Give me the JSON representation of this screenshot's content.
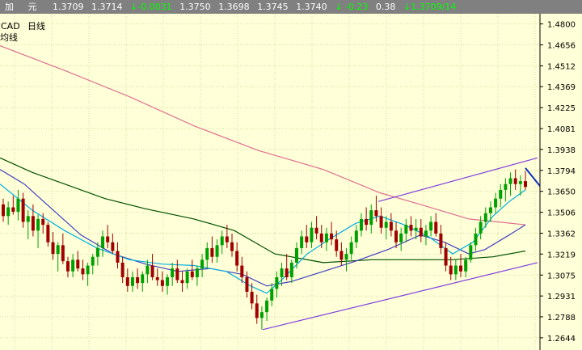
{
  "quote_bar": {
    "label1": "加",
    "label2": "元",
    "open": "1.3709",
    "high": "1.3714",
    "change_arrow": "↓",
    "change": "-0.0031",
    "v1": "1.3750",
    "v2": "1.3698",
    "v3": "1.3745",
    "v4": "1.3740",
    "pct_arrow": "↓",
    "pct": "-0.23",
    "vol": "0.38",
    "last_arrow": "↓",
    "last": "1.3709/14"
  },
  "colors": {
    "background": "#ffffd8",
    "grid": "#cfe0a0",
    "up_candle": "#00a000",
    "down_candle": "#a00000",
    "ma_fast": "#00b0e0",
    "ma_mid": "#4040c0",
    "ma_slow": "#005000",
    "ma_long": "#e07090",
    "channel": "#8040e0",
    "arrow": "#1030c0"
  },
  "chart_data": {
    "type": "candlestick",
    "symbol": "CAD",
    "timeframe": "日线",
    "sub_label": "均线",
    "y_ticks": [
      "1.4800",
      "1.4656",
      "1.4512",
      "1.4369",
      "1.4225",
      "1.4081",
      "1.3938",
      "1.3794",
      "1.3650",
      "1.3506",
      "1.3362",
      "1.3219",
      "1.3075",
      "1.2931",
      "1.2788",
      "1.2644"
    ],
    "ylim": [
      1.256,
      1.487
    ],
    "x_range": [
      0,
      720
    ],
    "candles": [
      [
        1.356,
        1.36,
        1.344,
        1.348
      ],
      [
        1.348,
        1.358,
        1.342,
        1.354
      ],
      [
        1.354,
        1.362,
        1.349,
        1.351
      ],
      [
        1.351,
        1.366,
        1.345,
        1.36
      ],
      [
        1.36,
        1.364,
        1.34,
        1.344
      ],
      [
        1.344,
        1.352,
        1.332,
        1.348
      ],
      [
        1.348,
        1.356,
        1.334,
        1.338
      ],
      [
        1.338,
        1.349,
        1.326,
        1.346
      ],
      [
        1.346,
        1.35,
        1.336,
        1.342
      ],
      [
        1.342,
        1.344,
        1.327,
        1.33
      ],
      [
        1.33,
        1.337,
        1.318,
        1.322
      ],
      [
        1.322,
        1.33,
        1.31,
        1.328
      ],
      [
        1.328,
        1.336,
        1.315,
        1.317
      ],
      [
        1.317,
        1.32,
        1.306,
        1.31
      ],
      [
        1.31,
        1.322,
        1.306,
        1.318
      ],
      [
        1.318,
        1.324,
        1.31,
        1.312
      ],
      [
        1.312,
        1.318,
        1.304,
        1.308
      ],
      [
        1.308,
        1.316,
        1.3,
        1.314
      ],
      [
        1.314,
        1.322,
        1.308,
        1.32
      ],
      [
        1.32,
        1.33,
        1.314,
        1.326
      ],
      [
        1.326,
        1.338,
        1.32,
        1.334
      ],
      [
        1.334,
        1.342,
        1.326,
        1.33
      ],
      [
        1.33,
        1.336,
        1.322,
        1.324
      ],
      [
        1.324,
        1.33,
        1.312,
        1.316
      ],
      [
        1.316,
        1.32,
        1.302,
        1.306
      ],
      [
        1.306,
        1.312,
        1.296,
        1.3
      ],
      [
        1.3,
        1.31,
        1.296,
        1.306
      ],
      [
        1.306,
        1.312,
        1.298,
        1.302
      ],
      [
        1.302,
        1.31,
        1.296,
        1.308
      ],
      [
        1.308,
        1.318,
        1.302,
        1.314
      ],
      [
        1.314,
        1.322,
        1.304,
        1.306
      ],
      [
        1.306,
        1.312,
        1.3,
        1.304
      ],
      [
        1.304,
        1.31,
        1.296,
        1.3
      ],
      [
        1.3,
        1.308,
        1.294,
        1.306
      ],
      [
        1.306,
        1.316,
        1.3,
        1.312
      ],
      [
        1.312,
        1.318,
        1.302,
        1.304
      ],
      [
        1.304,
        1.31,
        1.296,
        1.302
      ],
      [
        1.302,
        1.312,
        1.298,
        1.31
      ],
      [
        1.31,
        1.318,
        1.304,
        1.306
      ],
      [
        1.306,
        1.314,
        1.3,
        1.312
      ],
      [
        1.312,
        1.322,
        1.306,
        1.318
      ],
      [
        1.318,
        1.33,
        1.312,
        1.326
      ],
      [
        1.326,
        1.334,
        1.316,
        1.32
      ],
      [
        1.32,
        1.332,
        1.316,
        1.328
      ],
      [
        1.328,
        1.338,
        1.322,
        1.334
      ],
      [
        1.334,
        1.342,
        1.326,
        1.33
      ],
      [
        1.33,
        1.336,
        1.32,
        1.324
      ],
      [
        1.324,
        1.33,
        1.31,
        1.314
      ],
      [
        1.314,
        1.32,
        1.302,
        1.306
      ],
      [
        1.306,
        1.31,
        1.292,
        1.296
      ],
      [
        1.296,
        1.302,
        1.284,
        1.288
      ],
      [
        1.288,
        1.294,
        1.274,
        1.278
      ],
      [
        1.278,
        1.286,
        1.27,
        1.282
      ],
      [
        1.282,
        1.292,
        1.276,
        1.29
      ],
      [
        1.29,
        1.302,
        1.286,
        1.298
      ],
      [
        1.298,
        1.31,
        1.292,
        1.306
      ],
      [
        1.306,
        1.316,
        1.3,
        1.312
      ],
      [
        1.312,
        1.322,
        1.304,
        1.306
      ],
      [
        1.306,
        1.318,
        1.302,
        1.316
      ],
      [
        1.316,
        1.33,
        1.312,
        1.326
      ],
      [
        1.326,
        1.338,
        1.322,
        1.334
      ],
      [
        1.334,
        1.342,
        1.326,
        1.33
      ],
      [
        1.33,
        1.344,
        1.326,
        1.34
      ],
      [
        1.34,
        1.348,
        1.332,
        1.336
      ],
      [
        1.336,
        1.342,
        1.326,
        1.33
      ],
      [
        1.33,
        1.34,
        1.324,
        1.336
      ],
      [
        1.336,
        1.344,
        1.328,
        1.332
      ],
      [
        1.332,
        1.338,
        1.32,
        1.324
      ],
      [
        1.324,
        1.33,
        1.314,
        1.318
      ],
      [
        1.318,
        1.326,
        1.31,
        1.322
      ],
      [
        1.322,
        1.334,
        1.318,
        1.33
      ],
      [
        1.33,
        1.342,
        1.326,
        1.338
      ],
      [
        1.338,
        1.35,
        1.334,
        1.346
      ],
      [
        1.346,
        1.354,
        1.338,
        1.342
      ],
      [
        1.342,
        1.356,
        1.336,
        1.352
      ],
      [
        1.352,
        1.362,
        1.344,
        1.348
      ],
      [
        1.348,
        1.354,
        1.336,
        1.34
      ],
      [
        1.34,
        1.348,
        1.332,
        1.344
      ],
      [
        1.344,
        1.35,
        1.334,
        1.338
      ],
      [
        1.338,
        1.344,
        1.326,
        1.33
      ],
      [
        1.33,
        1.34,
        1.324,
        1.336
      ],
      [
        1.336,
        1.346,
        1.33,
        1.342
      ],
      [
        1.342,
        1.348,
        1.334,
        1.338
      ],
      [
        1.338,
        1.346,
        1.332,
        1.34
      ],
      [
        1.34,
        1.346,
        1.33,
        1.334
      ],
      [
        1.334,
        1.342,
        1.328,
        1.338
      ],
      [
        1.338,
        1.348,
        1.334,
        1.344
      ],
      [
        1.344,
        1.35,
        1.334,
        1.336
      ],
      [
        1.336,
        1.342,
        1.322,
        1.326
      ],
      [
        1.326,
        1.33,
        1.31,
        1.314
      ],
      [
        1.314,
        1.32,
        1.304,
        1.308
      ],
      [
        1.308,
        1.318,
        1.304,
        1.314
      ],
      [
        1.314,
        1.322,
        1.306,
        1.31
      ],
      [
        1.31,
        1.32,
        1.306,
        1.318
      ],
      [
        1.318,
        1.33,
        1.316,
        1.328
      ],
      [
        1.328,
        1.34,
        1.324,
        1.336
      ],
      [
        1.336,
        1.348,
        1.332,
        1.344
      ],
      [
        1.344,
        1.354,
        1.34,
        1.35
      ],
      [
        1.35,
        1.358,
        1.344,
        1.354
      ],
      [
        1.354,
        1.364,
        1.35,
        1.36
      ],
      [
        1.36,
        1.37,
        1.354,
        1.366
      ],
      [
        1.366,
        1.374,
        1.358,
        1.37
      ],
      [
        1.37,
        1.378,
        1.362,
        1.374
      ],
      [
        1.374,
        1.38,
        1.366,
        1.37
      ],
      [
        1.37,
        1.376,
        1.362,
        1.372
      ],
      [
        1.372,
        1.379,
        1.366,
        1.368
      ]
    ],
    "ma_long": [
      [
        0,
        1.465
      ],
      [
        80,
        1.448
      ],
      [
        160,
        1.43
      ],
      [
        240,
        1.41
      ],
      [
        320,
        1.393
      ],
      [
        400,
        1.38
      ],
      [
        470,
        1.364
      ],
      [
        520,
        1.356
      ],
      [
        580,
        1.346
      ],
      [
        650,
        1.342
      ]
    ],
    "ma_slow": [
      [
        0,
        1.388
      ],
      [
        40,
        1.378
      ],
      [
        80,
        1.37
      ],
      [
        130,
        1.36
      ],
      [
        180,
        1.353
      ],
      [
        240,
        1.346
      ],
      [
        290,
        1.338
      ],
      [
        340,
        1.322
      ],
      [
        400,
        1.316
      ],
      [
        460,
        1.318
      ],
      [
        500,
        1.318
      ],
      [
        560,
        1.318
      ],
      [
        610,
        1.32
      ],
      [
        650,
        1.324
      ]
    ],
    "ma_mid": [
      [
        0,
        1.38
      ],
      [
        30,
        1.37
      ],
      [
        60,
        1.355
      ],
      [
        100,
        1.335
      ],
      [
        140,
        1.322
      ],
      [
        180,
        1.315
      ],
      [
        220,
        1.31
      ],
      [
        260,
        1.312
      ],
      [
        300,
        1.308
      ],
      [
        330,
        1.3
      ],
      [
        360,
        1.303
      ],
      [
        400,
        1.31
      ],
      [
        440,
        1.317
      ],
      [
        480,
        1.325
      ],
      [
        520,
        1.335
      ],
      [
        550,
        1.33
      ],
      [
        580,
        1.322
      ],
      [
        600,
        1.325
      ],
      [
        630,
        1.335
      ],
      [
        650,
        1.342
      ]
    ],
    "ma_fast": [
      [
        0,
        1.37
      ],
      [
        40,
        1.352
      ],
      [
        80,
        1.338
      ],
      [
        120,
        1.326
      ],
      [
        160,
        1.318
      ],
      [
        200,
        1.315
      ],
      [
        240,
        1.314
      ],
      [
        280,
        1.31
      ],
      [
        310,
        1.3
      ],
      [
        330,
        1.295
      ],
      [
        350,
        1.305
      ],
      [
        380,
        1.322
      ],
      [
        410,
        1.333
      ],
      [
        440,
        1.343
      ],
      [
        470,
        1.348
      ],
      [
        500,
        1.342
      ],
      [
        530,
        1.334
      ],
      [
        560,
        1.322
      ],
      [
        585,
        1.33
      ],
      [
        610,
        1.348
      ],
      [
        630,
        1.358
      ],
      [
        650,
        1.366
      ]
    ],
    "channel_upper": [
      [
        468,
        1.358
      ],
      [
        665,
        1.388
      ]
    ],
    "channel_lower": [
      [
        325,
        1.27
      ],
      [
        665,
        1.316
      ]
    ],
    "forecast_arrow": [
      [
        650,
        1.381
      ],
      [
        685,
        1.357
      ]
    ]
  }
}
